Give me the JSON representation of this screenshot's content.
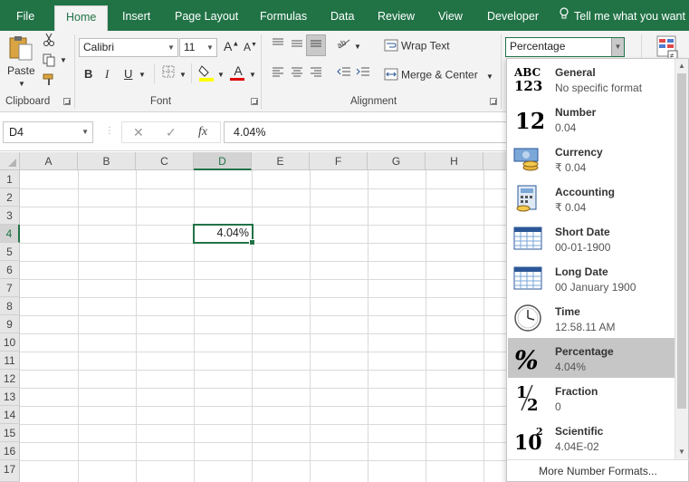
{
  "menu": {
    "tabs": [
      "File",
      "Home",
      "Insert",
      "Page Layout",
      "Formulas",
      "Data",
      "Review",
      "View",
      "Developer"
    ],
    "active_tab": "Home",
    "tell_me": "Tell me what you want"
  },
  "ribbon": {
    "clipboard": {
      "paste_label": "Paste",
      "group_label": "Clipboard"
    },
    "font": {
      "font_name": "Calibri",
      "font_size": "11",
      "group_label": "Font",
      "bold": "B",
      "italic": "I",
      "underline": "U",
      "grow": "A",
      "shrink": "A",
      "color_letter": "A"
    },
    "alignment": {
      "wrap_text": "Wrap Text",
      "merge_center": "Merge & Center",
      "group_label": "Alignment"
    },
    "number": {
      "format_value": "Percentage"
    }
  },
  "formula_bar": {
    "name_box": "D4",
    "cancel": "✕",
    "enter": "✓",
    "fx": "fx",
    "value": "4.04%"
  },
  "grid": {
    "columns": [
      "A",
      "B",
      "C",
      "D",
      "E",
      "F",
      "G",
      "H"
    ],
    "rows": [
      "1",
      "2",
      "3",
      "4",
      "5",
      "6",
      "7",
      "8",
      "9",
      "10",
      "11",
      "12",
      "13",
      "14",
      "15",
      "16",
      "17"
    ],
    "selected_column": "D",
    "selected_row": "4",
    "active_cell_value": "4.04%"
  },
  "number_format_dropdown": {
    "items": [
      {
        "name": "General",
        "sample": "No specific format",
        "icon": "abc-123-icon"
      },
      {
        "name": "Number",
        "sample": "0.04",
        "icon": "number-12-icon"
      },
      {
        "name": "Currency",
        "sample": "₹ 0.04",
        "icon": "currency-icon"
      },
      {
        "name": "Accounting",
        "sample": "₹ 0.04",
        "icon": "accounting-icon"
      },
      {
        "name": "Short Date",
        "sample": "00-01-1900",
        "icon": "calendar-icon"
      },
      {
        "name": "Long Date",
        "sample": "00 January 1900",
        "icon": "calendar-icon"
      },
      {
        "name": "Time",
        "sample": "12.58.11 AM",
        "icon": "clock-icon"
      },
      {
        "name": "Percentage",
        "sample": "4.04%",
        "icon": "percent-icon"
      },
      {
        "name": "Fraction",
        "sample": "0",
        "icon": "fraction-icon"
      },
      {
        "name": "Scientific",
        "sample": "4.04E-02",
        "icon": "scientific-icon"
      }
    ],
    "selected": "Percentage",
    "more_formats": "More Number Formats..."
  },
  "colors": {
    "brand": "#217346",
    "ribbon_bg": "#f3f3f3",
    "selected_item": "#c6c6c6"
  }
}
